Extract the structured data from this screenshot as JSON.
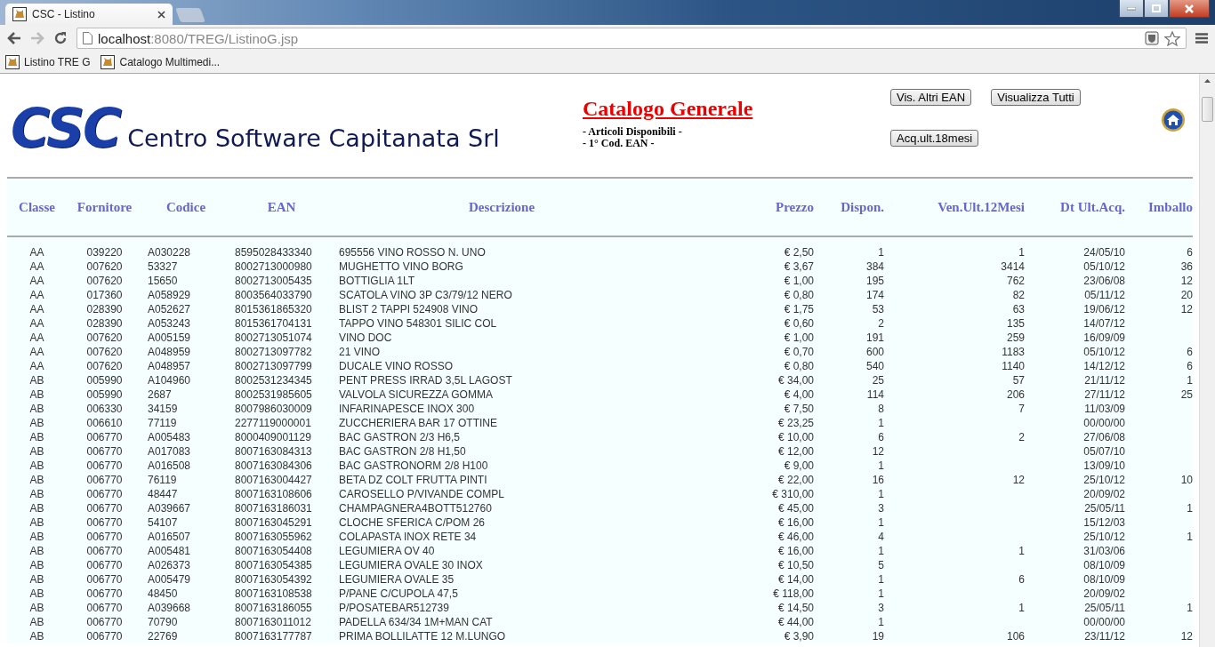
{
  "browser": {
    "tab_title": "CSC - Listino",
    "url_host": "localhost",
    "url_rest": ":8080/TREG/ListinoG.jsp",
    "bookmarks": [
      "Listino TRE G",
      "Catalogo Multimedi..."
    ]
  },
  "header": {
    "logo_mark": "CSC",
    "logo_text": "Centro Software Capitanata Srl",
    "title": "Catalogo Generale",
    "subtitles": [
      "- Articoli Disponibili -",
      "- 1° Cod. EAN -"
    ],
    "buttons": [
      "Vis. Altri EAN",
      "Visualizza Tutti",
      "Acq.ult.18mesi"
    ]
  },
  "table": {
    "columns": [
      "Classe",
      "Fornitore",
      "Codice",
      "EAN",
      "Descrizione",
      "Prezzo",
      "Dispon.",
      "Ven.Ult.12Mesi",
      "Dt Ult.Acq.",
      "Imballo"
    ],
    "rows": [
      {
        "classe": "AA",
        "fornitore": "039220",
        "codice": "A030228",
        "ean": "8595028433340",
        "descrizione": "695556 VINO ROSSO N. UNO",
        "prezzo": "€ 2,50",
        "dispon": "1",
        "vendite": "1",
        "dt_ult_acq": "24/05/10",
        "imballo": "6"
      },
      {
        "classe": "AA",
        "fornitore": "007620",
        "codice": "53327",
        "ean": "8002713000980",
        "descrizione": "MUGHETTO VINO BORG",
        "prezzo": "€ 3,67",
        "dispon": "384",
        "vendite": "3414",
        "dt_ult_acq": "05/10/12",
        "imballo": "36"
      },
      {
        "classe": "AA",
        "fornitore": "007620",
        "codice": "15650",
        "ean": "8002713005435",
        "descrizione": "BOTTIGLIA 1LT",
        "prezzo": "€ 1,00",
        "dispon": "195",
        "vendite": "762",
        "dt_ult_acq": "23/06/08",
        "imballo": "12"
      },
      {
        "classe": "AA",
        "fornitore": "017360",
        "codice": "A058929",
        "ean": "8003564033790",
        "descrizione": "SCATOLA VINO 3P C3/79/12 NERO",
        "prezzo": "€ 0,80",
        "dispon": "174",
        "vendite": "82",
        "dt_ult_acq": "05/11/12",
        "imballo": "20"
      },
      {
        "classe": "AA",
        "fornitore": "028390",
        "codice": "A052627",
        "ean": "8015361865320",
        "descrizione": "BLIST 2 TAPPI 524908 VINO",
        "prezzo": "€ 1,75",
        "dispon": "53",
        "vendite": "63",
        "dt_ult_acq": "19/06/12",
        "imballo": "12"
      },
      {
        "classe": "AA",
        "fornitore": "028390",
        "codice": "A053243",
        "ean": "8015361704131",
        "descrizione": "TAPPO VINO 548301 SILIC COL",
        "prezzo": "€ 0,60",
        "dispon": "2",
        "vendite": "135",
        "dt_ult_acq": "14/07/12"
      },
      {
        "classe": "AA",
        "fornitore": "007620",
        "codice": "A005159",
        "ean": "8002713051074",
        "descrizione": "VINO DOC",
        "prezzo": "€ 1,00",
        "dispon": "191",
        "vendite": "259",
        "dt_ult_acq": "16/09/09"
      },
      {
        "classe": "AA",
        "fornitore": "007620",
        "codice": "A048959",
        "ean": "8002713097782",
        "descrizione": "21 VINO",
        "prezzo": "€ 0,70",
        "dispon": "600",
        "vendite": "1183",
        "dt_ult_acq": "05/10/12",
        "imballo": "6"
      },
      {
        "classe": "AA",
        "fornitore": "007620",
        "codice": "A048957",
        "ean": "8002713097799",
        "descrizione": "DUCALE VINO ROSSO",
        "prezzo": "€ 0,80",
        "dispon": "540",
        "vendite": "1140",
        "dt_ult_acq": "14/12/12",
        "imballo": "6"
      },
      {
        "classe": "AB",
        "fornitore": "005990",
        "codice": "A104960",
        "ean": "8002531234345",
        "descrizione": "PENT PRESS IRRAD 3,5L LAGOST",
        "prezzo": "€ 34,00",
        "dispon": "25",
        "vendite": "57",
        "dt_ult_acq": "21/11/12",
        "imballo": "1"
      },
      {
        "classe": "AB",
        "fornitore": "005990",
        "codice": "2687",
        "ean": "8002531985605",
        "descrizione": "VALVOLA SICUREZZA GOMMA",
        "prezzo": "€ 4,00",
        "dispon": "114",
        "vendite": "206",
        "dt_ult_acq": "27/11/12",
        "imballo": "25"
      },
      {
        "classe": "AB",
        "fornitore": "006330",
        "codice": "34159",
        "ean": "8007986030009",
        "descrizione": "INFARINAPESCE INOX 300",
        "prezzo": "€ 7,50",
        "dispon": "8",
        "vendite": "7",
        "dt_ult_acq": "11/03/09"
      },
      {
        "classe": "AB",
        "fornitore": "006610",
        "codice": "77119",
        "ean": "2277119000001",
        "descrizione": "ZUCCHERIERA BAR 17 OTTINE",
        "prezzo": "€ 23,25",
        "dispon": "1",
        "dt_ult_acq": "00/00/00"
      },
      {
        "classe": "AB",
        "fornitore": "006770",
        "codice": "A005483",
        "ean": "8000409001129",
        "descrizione": "BAC GASTRON 2/3 H6,5",
        "prezzo": "€ 10,00",
        "dispon": "6",
        "vendite": "2",
        "dt_ult_acq": "27/06/08"
      },
      {
        "classe": "AB",
        "fornitore": "006770",
        "codice": "A017083",
        "ean": "8007163084313",
        "descrizione": "BAC GASTRON 2/8 H1,50",
        "prezzo": "€ 12,00",
        "dispon": "12",
        "dt_ult_acq": "05/07/10"
      },
      {
        "classe": "AB",
        "fornitore": "006770",
        "codice": "A016508",
        "ean": "8007163084306",
        "descrizione": "BAC GASTRONORM 2/8 H100",
        "prezzo": "€ 9,00",
        "dispon": "1",
        "dt_ult_acq": "13/09/10"
      },
      {
        "classe": "AB",
        "fornitore": "006770",
        "codice": "76119",
        "ean": "8007163004427",
        "descrizione": "BETA DZ COLT FRUTTA PINTI",
        "prezzo": "€ 22,00",
        "dispon": "16",
        "vendite": "12",
        "dt_ult_acq": "25/10/12",
        "imballo": "10"
      },
      {
        "classe": "AB",
        "fornitore": "006770",
        "codice": "48447",
        "ean": "8007163108606",
        "descrizione": "CAROSELLO P/VIVANDE COMPL",
        "prezzo": "€ 310,00",
        "dispon": "1",
        "dt_ult_acq": "20/09/02"
      },
      {
        "classe": "AB",
        "fornitore": "006770",
        "codice": "A039667",
        "ean": "8007163186031",
        "descrizione": "CHAMPAGNERA4BOTT512760",
        "prezzo": "€ 45,00",
        "dispon": "3",
        "dt_ult_acq": "25/05/11",
        "imballo": "1"
      },
      {
        "classe": "AB",
        "fornitore": "006770",
        "codice": "54107",
        "ean": "8007163045291",
        "descrizione": "CLOCHE SFERICA C/POM 26",
        "prezzo": "€ 16,00",
        "dispon": "1",
        "dt_ult_acq": "15/12/03"
      },
      {
        "classe": "AB",
        "fornitore": "006770",
        "codice": "A016507",
        "ean": "8007163055962",
        "descrizione": "COLAPASTA INOX RETE 34",
        "prezzo": "€ 46,00",
        "dispon": "4",
        "dt_ult_acq": "25/10/12",
        "imballo": "1"
      },
      {
        "classe": "AB",
        "fornitore": "006770",
        "codice": "A005481",
        "ean": "8007163054408",
        "descrizione": "LEGUMIERA OV 40",
        "prezzo": "€ 16,00",
        "dispon": "1",
        "vendite": "1",
        "dt_ult_acq": "31/03/06"
      },
      {
        "classe": "AB",
        "fornitore": "006770",
        "codice": "A026373",
        "ean": "8007163054385",
        "descrizione": "LEGUMIERA OVALE 30 INOX",
        "prezzo": "€ 10,50",
        "dispon": "5",
        "dt_ult_acq": "08/10/09"
      },
      {
        "classe": "AB",
        "fornitore": "006770",
        "codice": "A005479",
        "ean": "8007163054392",
        "descrizione": "LEGUMIERA OVALE 35",
        "prezzo": "€ 14,00",
        "dispon": "1",
        "vendite": "6",
        "dt_ult_acq": "08/10/09"
      },
      {
        "classe": "AB",
        "fornitore": "006770",
        "codice": "48450",
        "ean": "8007163108538",
        "descrizione": "P/PANE C/CUPOLA 47,5",
        "prezzo": "€ 118,00",
        "dispon": "1",
        "dt_ult_acq": "20/09/02"
      },
      {
        "classe": "AB",
        "fornitore": "006770",
        "codice": "A039668",
        "ean": "8007163186055",
        "descrizione": "P/POSATEBAR512739",
        "prezzo": "€ 14,50",
        "dispon": "3",
        "vendite": "1",
        "dt_ult_acq": "25/05/11",
        "imballo": "1"
      },
      {
        "classe": "AB",
        "fornitore": "006770",
        "codice": "70790",
        "ean": "8007163011012",
        "descrizione": "PADELLA 634/34 1M+MAN CAT",
        "prezzo": "€ 44,00",
        "dispon": "1",
        "dt_ult_acq": "00/00/00"
      },
      {
        "classe": "AB",
        "fornitore": "006770",
        "codice": "22769",
        "ean": "8007163177787",
        "descrizione": "PRIMA BOLLILATTE 12 M.LUNGO",
        "prezzo": "€ 3,90",
        "dispon": "19",
        "vendite": "106",
        "dt_ult_acq": "23/11/12",
        "imballo": "12"
      }
    ]
  }
}
